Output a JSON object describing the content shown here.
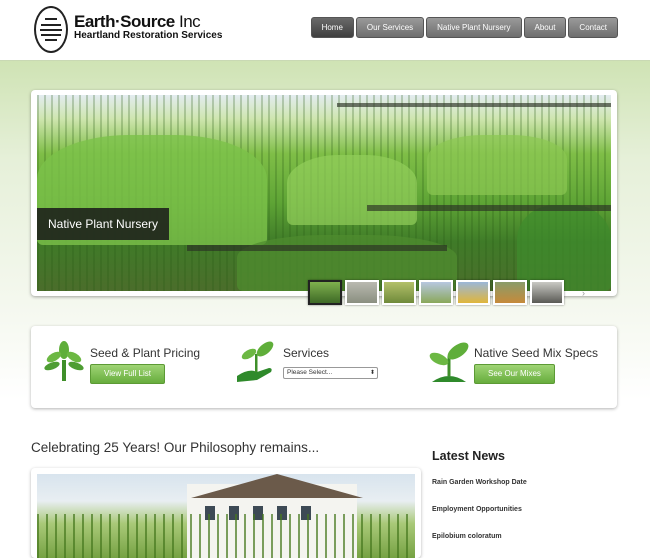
{
  "logo": {
    "name": "Earth·Source",
    "suffix": "Inc",
    "tagline": "Heartland Restoration Services"
  },
  "nav": {
    "items": [
      "Home",
      "Our Services",
      "Native Plant Nursery",
      "About",
      "Contact"
    ],
    "active": "Home"
  },
  "slider": {
    "caption": "Native Plant Nursery",
    "thumbnail_count": 7,
    "selected_thumbnail": 1
  },
  "features": {
    "pricing": {
      "title": "Seed & Plant Pricing",
      "button": "View Full List",
      "icon": "tree-icon"
    },
    "services": {
      "title": "Services",
      "select_value": "Please Select...",
      "icon": "hand-sprout-icon"
    },
    "seed_mix": {
      "title": "Native Seed Mix Specs",
      "button": "See Our Mixes",
      "icon": "sprout-icon"
    }
  },
  "philosophy": {
    "title": "Celebrating 25 Years!  Our Philosophy remains..."
  },
  "news": {
    "title": "Latest News",
    "items": [
      "Rain Garden Workshop Date",
      "Employment Opportunities",
      "Epilobium coloratum"
    ]
  },
  "colors": {
    "accent_green": "#78bb4a",
    "nav_gray": "#7a7a7a",
    "caption_bg": "#1e1e1e"
  }
}
